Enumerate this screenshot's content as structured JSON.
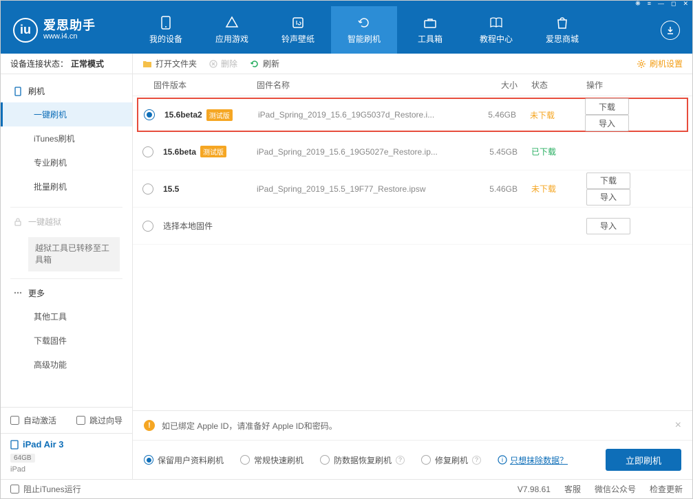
{
  "window_controls": [
    "❋",
    "≡",
    "—",
    "◻",
    "✕"
  ],
  "logo": {
    "badge": "iu",
    "title": "爱思助手",
    "url": "www.i4.cn"
  },
  "nav": [
    {
      "label": "我的设备"
    },
    {
      "label": "应用游戏"
    },
    {
      "label": "铃声壁纸"
    },
    {
      "label": "智能刷机",
      "active": true
    },
    {
      "label": "工具箱"
    },
    {
      "label": "教程中心"
    },
    {
      "label": "爱思商城"
    }
  ],
  "status": {
    "label": "设备连接状态：",
    "value": "正常模式"
  },
  "sidebar": {
    "flash_head": "刷机",
    "flash_items": [
      "一键刷机",
      "iTunes刷机",
      "专业刷机",
      "批量刷机"
    ],
    "jailbreak_head": "一键越狱",
    "jailbreak_note": "越狱工具已转移至工具箱",
    "more_head": "更多",
    "more_items": [
      "其他工具",
      "下载固件",
      "高级功能"
    ],
    "auto_activate": "自动激活",
    "skip_guide": "跳过向导",
    "device_name": "iPad Air 3",
    "device_storage": "64GB",
    "device_type": "iPad"
  },
  "toolbar": {
    "open": "打开文件夹",
    "delete": "删除",
    "refresh": "刷新",
    "settings": "刷机设置"
  },
  "columns": {
    "version": "固件版本",
    "name": "固件名称",
    "size": "大小",
    "status": "状态",
    "ops": "操作"
  },
  "rows": [
    {
      "selected": true,
      "highlight": true,
      "version": "15.6beta2",
      "beta": "测试版",
      "name": "iPad_Spring_2019_15.6_19G5037d_Restore.i...",
      "size": "5.46GB",
      "status": "未下载",
      "status_class": "nd",
      "dl": "下载",
      "imp": "导入"
    },
    {
      "selected": false,
      "version": "15.6beta",
      "beta": "测试版",
      "name": "iPad_Spring_2019_15.6_19G5027e_Restore.ip...",
      "size": "5.45GB",
      "status": "已下载",
      "status_class": "dl"
    },
    {
      "selected": false,
      "version": "15.5",
      "name": "iPad_Spring_2019_15.5_19F77_Restore.ipsw",
      "size": "5.46GB",
      "status": "未下载",
      "status_class": "nd",
      "dl": "下载",
      "imp": "导入"
    },
    {
      "selected": false,
      "local": true,
      "version_label": "选择本地固件",
      "imp": "导入"
    }
  ],
  "warning": "如已绑定 Apple ID，请准备好 Apple ID和密码。",
  "flash_opts": [
    {
      "label": "保留用户资料刷机",
      "sel": true
    },
    {
      "label": "常规快速刷机"
    },
    {
      "label": "防数据恢复刷机",
      "help": true
    },
    {
      "label": "修复刷机",
      "help": true
    }
  ],
  "erase_link": "只想抹除数据？",
  "flash_now": "立即刷机",
  "footer": {
    "block_itunes": "阻止iTunes运行",
    "version": "V7.98.61",
    "support": "客服",
    "wechat": "微信公众号",
    "update": "检查更新"
  }
}
